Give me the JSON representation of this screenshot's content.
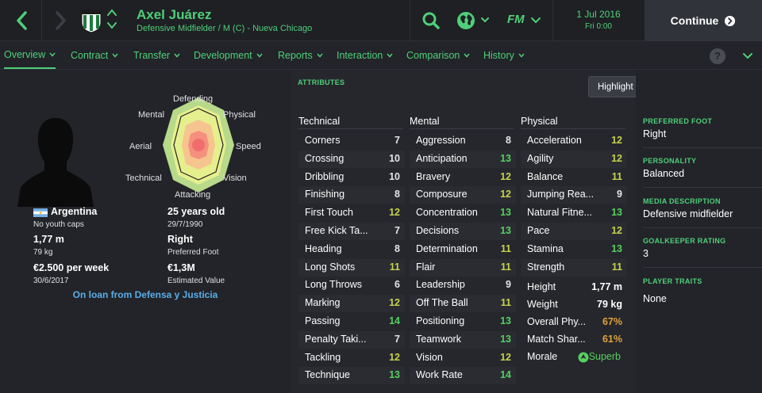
{
  "header": {
    "player_name": "Axel Juárez",
    "player_subtitle": "Defensive Midfielder / M (C) - Nueva Chicago",
    "date": "1 Jul 2016",
    "time": "Fri 0:00",
    "continue_label": "Continue",
    "fm_label": "FM"
  },
  "tabs": [
    {
      "label": "Overview",
      "active": true
    },
    {
      "label": "Contract"
    },
    {
      "label": "Transfer"
    },
    {
      "label": "Development"
    },
    {
      "label": "Reports"
    },
    {
      "label": "Interaction"
    },
    {
      "label": "Comparison"
    },
    {
      "label": "History"
    }
  ],
  "help_label": "?",
  "radar_labels": {
    "defending": "Defending",
    "physical": "Physical",
    "speed": "Speed",
    "vision": "Vision",
    "attacking": "Attacking",
    "technical": "Technical",
    "aerial": "Aerial",
    "mental": "Mental"
  },
  "profile": {
    "nationality": "Argentina",
    "youth_caps": "No youth caps",
    "height": "1,77 m",
    "weight": "79 kg",
    "wage": "€2.500 per week",
    "contract_end": "30/6/2017",
    "age": "25 years old",
    "dob": "29/7/1990",
    "foot": "Right",
    "foot_label": "Preferred Foot",
    "value": "€1,3M",
    "value_label": "Estimated Value",
    "loan": "On loan from Defensa y Justicia"
  },
  "attributes": {
    "heading": "ATTRIBUTES",
    "highlight_button": "Highlight key attributes for role",
    "technical_title": "Technical",
    "mental_title": "Mental",
    "physical_title": "Physical",
    "technical": [
      {
        "name": "Corners",
        "value": "7"
      },
      {
        "name": "Crossing",
        "value": "10"
      },
      {
        "name": "Dribbling",
        "value": "10"
      },
      {
        "name": "Finishing",
        "value": "8"
      },
      {
        "name": "First Touch",
        "value": "12"
      },
      {
        "name": "Free Kick Ta...",
        "value": "7"
      },
      {
        "name": "Heading",
        "value": "8"
      },
      {
        "name": "Long Shots",
        "value": "11"
      },
      {
        "name": "Long Throws",
        "value": "6"
      },
      {
        "name": "Marking",
        "value": "12"
      },
      {
        "name": "Passing",
        "value": "14"
      },
      {
        "name": "Penalty Taki...",
        "value": "7"
      },
      {
        "name": "Tackling",
        "value": "12"
      },
      {
        "name": "Technique",
        "value": "13"
      }
    ],
    "mental": [
      {
        "name": "Aggression",
        "value": "8"
      },
      {
        "name": "Anticipation",
        "value": "13"
      },
      {
        "name": "Bravery",
        "value": "12"
      },
      {
        "name": "Composure",
        "value": "12"
      },
      {
        "name": "Concentration",
        "value": "13"
      },
      {
        "name": "Decisions",
        "value": "13"
      },
      {
        "name": "Determination",
        "value": "11"
      },
      {
        "name": "Flair",
        "value": "11"
      },
      {
        "name": "Leadership",
        "value": "9"
      },
      {
        "name": "Off The Ball",
        "value": "11"
      },
      {
        "name": "Positioning",
        "value": "13"
      },
      {
        "name": "Teamwork",
        "value": "13"
      },
      {
        "name": "Vision",
        "value": "12"
      },
      {
        "name": "Work Rate",
        "value": "14"
      }
    ],
    "physical": [
      {
        "name": "Acceleration",
        "value": "12"
      },
      {
        "name": "Agility",
        "value": "12"
      },
      {
        "name": "Balance",
        "value": "11"
      },
      {
        "name": "Jumping Rea...",
        "value": "9"
      },
      {
        "name": "Natural Fitne...",
        "value": "13"
      },
      {
        "name": "Pace",
        "value": "12"
      },
      {
        "name": "Stamina",
        "value": "13"
      },
      {
        "name": "Strength",
        "value": "11"
      }
    ],
    "physical_stats": [
      {
        "name": "Height",
        "value": "1,77 m"
      },
      {
        "name": "Weight",
        "value": "79 kg"
      },
      {
        "name": "Overall Phy...",
        "value": "67%"
      },
      {
        "name": "Match Shar...",
        "value": "61%"
      },
      {
        "name": "Morale",
        "value": "Superb"
      }
    ]
  },
  "side": {
    "foot_head": "PREFERRED FOOT",
    "foot_val": "Right",
    "personality_head": "PERSONALITY",
    "personality_val": "Balanced",
    "media_head": "MEDIA DESCRIPTION",
    "media_val": "Defensive midfielder",
    "gk_head": "GOALKEEPER RATING",
    "gk_val": "3",
    "traits_head": "PLAYER TRAITS",
    "traits_val": "None"
  },
  "colors": {
    "accent": "#4fcf79",
    "link": "#5aaee8",
    "attr_high": "#56d05e",
    "attr_mid": "#c8d24e",
    "attr_orange": "#e0a23a"
  }
}
